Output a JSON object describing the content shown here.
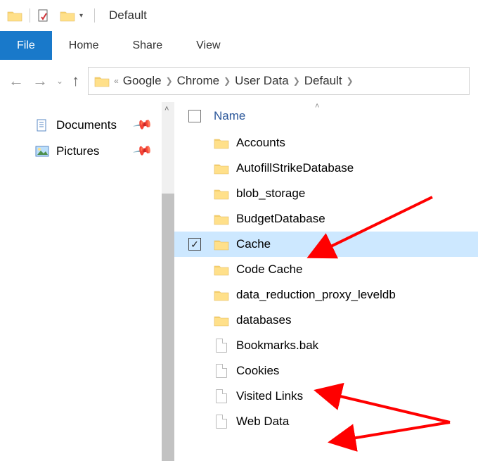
{
  "window": {
    "title": "Default"
  },
  "ribbon": {
    "file": "File",
    "tabs": [
      "Home",
      "Share",
      "View"
    ]
  },
  "breadcrumbs": [
    "Google",
    "Chrome",
    "User Data",
    "Default"
  ],
  "columns": {
    "name_header": "Name"
  },
  "sidebar": {
    "items": [
      {
        "label": "Documents"
      },
      {
        "label": "Pictures"
      }
    ]
  },
  "files": [
    {
      "name": "Accounts",
      "type": "folder",
      "selected": false
    },
    {
      "name": "AutofillStrikeDatabase",
      "type": "folder",
      "selected": false
    },
    {
      "name": "blob_storage",
      "type": "folder",
      "selected": false
    },
    {
      "name": "BudgetDatabase",
      "type": "folder",
      "selected": false
    },
    {
      "name": "Cache",
      "type": "folder",
      "selected": true
    },
    {
      "name": "Code Cache",
      "type": "folder",
      "selected": false
    },
    {
      "name": "data_reduction_proxy_leveldb",
      "type": "folder",
      "selected": false
    },
    {
      "name": "databases",
      "type": "folder",
      "selected": false
    },
    {
      "name": "Bookmarks.bak",
      "type": "file",
      "selected": false
    },
    {
      "name": "Cookies",
      "type": "file",
      "selected": false
    },
    {
      "name": "Visited Links",
      "type": "file",
      "selected": false
    },
    {
      "name": "Web Data",
      "type": "file",
      "selected": false
    }
  ]
}
